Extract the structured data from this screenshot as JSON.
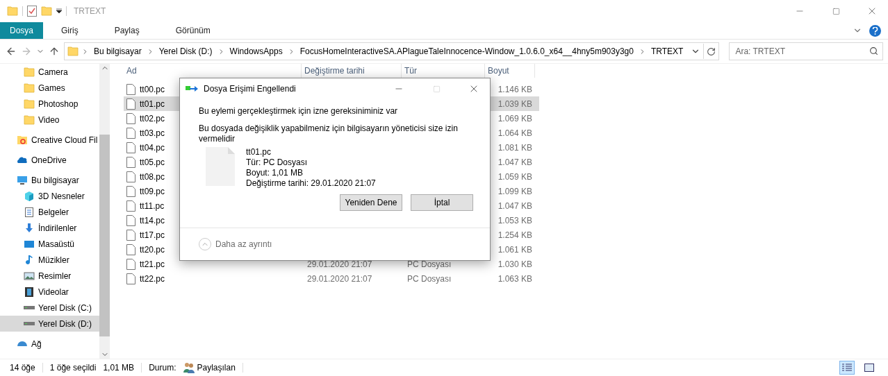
{
  "window": {
    "title": "TRTEXT"
  },
  "ribbon": {
    "tabs": [
      {
        "label": "Dosya",
        "selected": true
      },
      {
        "label": "Giriş",
        "selected": false
      },
      {
        "label": "Paylaş",
        "selected": false
      },
      {
        "label": "Görünüm",
        "selected": false
      }
    ]
  },
  "address": {
    "crumbs": [
      "Bu bilgisayar",
      "Yerel Disk (D:)",
      "WindowsApps",
      "FocusHomeInteractiveSA.APlagueTaleInnocence-Window_1.0.6.0_x64__4hny5m903y3g0",
      "TRTEXT"
    ]
  },
  "search": {
    "placeholder": "Ara: TRTEXT"
  },
  "sidebar": {
    "pinned": [
      {
        "label": "Camera",
        "kind": "folder",
        "selected": false
      },
      {
        "label": "Games",
        "kind": "folder",
        "selected": false
      },
      {
        "label": "Photoshop",
        "kind": "folder",
        "selected": false
      },
      {
        "label": "Video",
        "kind": "folder",
        "selected": false
      }
    ],
    "items": [
      {
        "label": "Creative Cloud Fil",
        "kind": "cloudfolder",
        "selected": false
      },
      {
        "label": "OneDrive",
        "kind": "onedrive",
        "selected": false
      },
      {
        "label": "Bu bilgisayar",
        "kind": "pc",
        "selected": false,
        "children": [
          {
            "label": "3D Nesneler",
            "kind": "cube",
            "selected": false
          },
          {
            "label": "Belgeler",
            "kind": "doc",
            "selected": false
          },
          {
            "label": "İndirilenler",
            "kind": "download",
            "selected": false
          },
          {
            "label": "Masaüstü",
            "kind": "desktop",
            "selected": false
          },
          {
            "label": "Müzikler",
            "kind": "music",
            "selected": false
          },
          {
            "label": "Resimler",
            "kind": "pictures",
            "selected": false
          },
          {
            "label": "Videolar",
            "kind": "film",
            "selected": false
          },
          {
            "label": "Yerel Disk (C:)",
            "kind": "drive",
            "selected": false
          },
          {
            "label": "Yerel Disk (D:)",
            "kind": "drive",
            "selected": true
          }
        ]
      },
      {
        "label": "Ağ",
        "kind": "network",
        "selected": false
      }
    ]
  },
  "table": {
    "columns": [
      "Ad",
      "Değiştirme tarihi",
      "Tür",
      "Boyut"
    ],
    "rows": [
      {
        "name": "tt00.pc",
        "size": "1.146 KB",
        "selected": false
      },
      {
        "name": "tt01.pc",
        "size": "1.039 KB",
        "selected": true
      },
      {
        "name": "tt02.pc",
        "size": "1.069 KB",
        "selected": false
      },
      {
        "name": "tt03.pc",
        "size": "1.064 KB",
        "selected": false
      },
      {
        "name": "tt04.pc",
        "size": "1.081 KB",
        "selected": false
      },
      {
        "name": "tt05.pc",
        "size": "1.047 KB",
        "selected": false
      },
      {
        "name": "tt08.pc",
        "size": "1.059 KB",
        "selected": false
      },
      {
        "name": "tt09.pc",
        "size": "1.099 KB",
        "selected": false
      },
      {
        "name": "tt11.pc",
        "size": "1.047 KB",
        "selected": false
      },
      {
        "name": "tt14.pc",
        "size": "1.053 KB",
        "selected": false
      },
      {
        "name": "tt17.pc",
        "size": "1.254 KB",
        "selected": false
      },
      {
        "name": "tt20.pc",
        "size": "1.061 KB",
        "selected": false
      },
      {
        "name": "tt21.pc",
        "date": "29.01.2020 21:07",
        "type": "PC Dosyası",
        "size": "1.030 KB",
        "selected": false
      },
      {
        "name": "tt22.pc",
        "date": "29.01.2020 21:07",
        "type": "PC Dosyası",
        "size": "1.063 KB",
        "selected": false
      }
    ]
  },
  "status_bar": {
    "count": "14 öğe",
    "selection": "1 öğe seçildi",
    "selection_size": "1,01 MB",
    "status_label": "Durum:",
    "status": "Paylaşılan",
    "views": [
      {
        "kind": "details",
        "selected": true
      },
      {
        "kind": "large",
        "selected": false
      }
    ]
  },
  "dialog": {
    "title": "Dosya Erişimi Engellendi",
    "heading": "Bu eylemi gerçekleştirmek için izne gereksiniminiz var",
    "message": "Bu dosyada değişiklik yapabilmeniz için bilgisayarın yöneticisi size izin vermelidir",
    "file": {
      "name": "tt01.pc",
      "type": "Tür: PC Dosyası",
      "size": "Boyut: 1,01 MB",
      "date": "Değiştirme tarihi: 29.01.2020 21:07"
    },
    "buttons": [
      "Yeniden Dene",
      "İptal"
    ],
    "details_toggle": "Daha az ayrıntı"
  }
}
